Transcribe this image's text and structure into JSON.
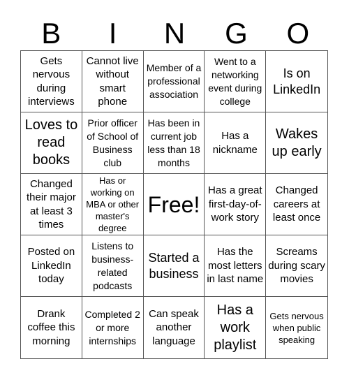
{
  "header": {
    "letters": [
      "B",
      "I",
      "N",
      "G",
      "O"
    ]
  },
  "cells": [
    "Gets nervous during interviews",
    "Cannot live without smart phone",
    "Member of a professional association",
    "Went to a networking event during college",
    "Is on LinkedIn",
    "Loves to read books",
    "Prior officer of School of Business club",
    "Has been in current job less than 18 months",
    "Has a nickname",
    "Wakes up early",
    "Changed their major at least 3 times",
    "Has or working on MBA or other master's degree",
    "Free!",
    "Has a great first-day-of-work story",
    "Changed careers at least once",
    "Posted on LinkedIn today",
    "Listens to business-related podcasts",
    "Started a business",
    "Has the most letters in last name",
    "Screams during scary movies",
    "Drank coffee this morning",
    "Completed 2 or more internships",
    "Can speak another language",
    "Has a work playlist",
    "Gets nervous when public speaking"
  ]
}
